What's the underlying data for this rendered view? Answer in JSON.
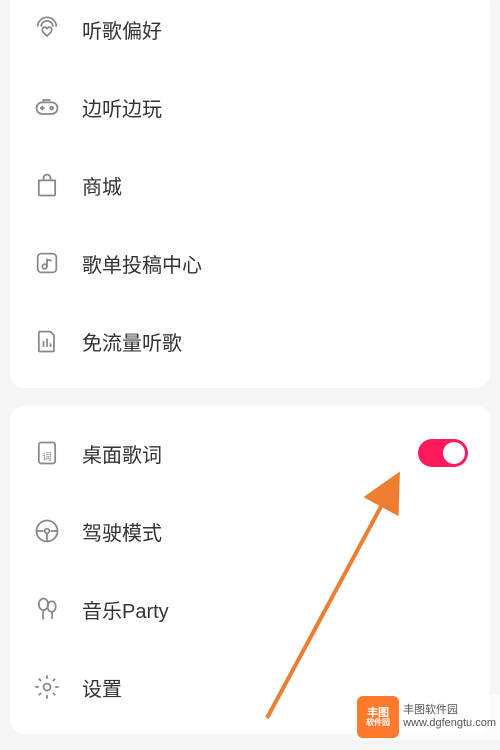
{
  "section1": {
    "items": [
      {
        "label": "听歌偏好",
        "icon": "heart-signal-icon"
      },
      {
        "label": "边听边玩",
        "icon": "gamepad-icon"
      },
      {
        "label": "商城",
        "icon": "bag-icon"
      },
      {
        "label": "歌单投稿中心",
        "icon": "playlist-submit-icon"
      },
      {
        "label": "免流量听歌",
        "icon": "sim-data-icon"
      }
    ]
  },
  "section2": {
    "items": [
      {
        "label": "桌面歌词",
        "icon": "lyrics-icon",
        "toggle": true,
        "toggle_on": true
      },
      {
        "label": "驾驶模式",
        "icon": "steering-wheel-icon"
      },
      {
        "label": "音乐Party",
        "icon": "balloons-icon"
      },
      {
        "label": "设置",
        "icon": "gear-icon"
      }
    ]
  },
  "watermark": {
    "brand_top": "丰图",
    "brand_bottom": "软件园",
    "line1": "丰图软件园",
    "line2": "www.dgfengtu.com"
  },
  "colors": {
    "toggle_on": "#ff1a5b",
    "arrow": "#ed7d31"
  }
}
